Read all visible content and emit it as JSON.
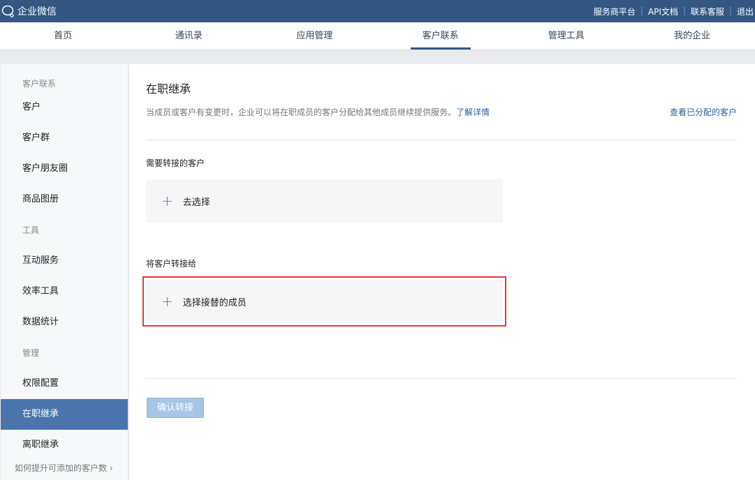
{
  "header": {
    "app_name": "企业微信",
    "links": [
      "服务商平台",
      "API文档",
      "联系客服",
      "退出"
    ]
  },
  "nav": {
    "tabs": [
      "首页",
      "通讯录",
      "应用管理",
      "客户联系",
      "管理工具",
      "我的企业"
    ],
    "active": 3
  },
  "sidebar": {
    "groups": [
      {
        "title": "客户联系",
        "items": [
          "客户",
          "客户群",
          "客户朋友圈",
          "商品图册"
        ]
      },
      {
        "title": "工具",
        "items": [
          "互动服务",
          "效率工具",
          "数据统计"
        ]
      },
      {
        "title": "管理",
        "items": [
          "权限配置",
          "在职继承",
          "离职继承"
        ]
      }
    ],
    "active": "在职继承",
    "more_link": "如何提升可添加的客户数"
  },
  "main": {
    "title": "在职继承",
    "description": "当成员或客户有变更时，企业可以将在职成员的客户分配给其他成员继续提供服务。",
    "learn_more": "了解详情",
    "view_assigned": "查看已分配的客户",
    "section1_label": "需要转接的客户",
    "section1_action": "去选择",
    "section2_label": "将客户转接给",
    "section2_action": "选择接替的成员",
    "confirm_button": "确认转接"
  }
}
